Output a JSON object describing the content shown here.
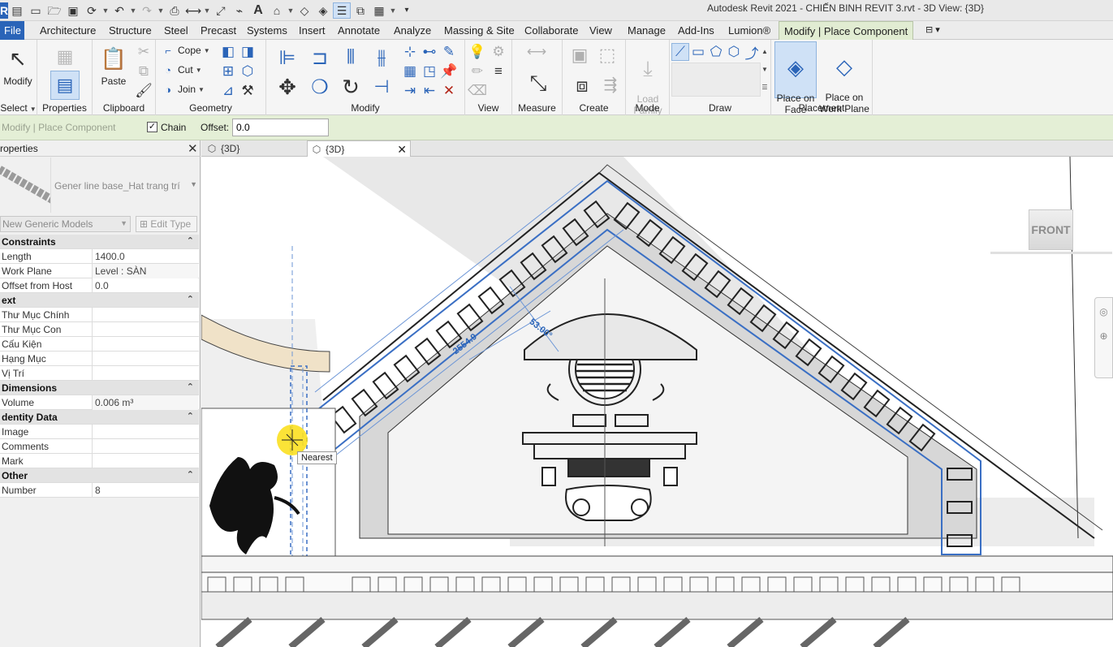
{
  "window": {
    "title": "Autodesk Revit 2021 - CHIẾN BINH REVIT 3.rvt - 3D View: {3D}"
  },
  "qat": {
    "icons": [
      "revit-logo",
      "open-icon",
      "new-icon",
      "open-folder-icon",
      "save-icon",
      "sync-icon",
      "undo-icon",
      "redo-icon",
      "print-icon",
      "measure-icon",
      "dimension-icon",
      "text-icon",
      "3d-view-icon",
      "section-icon",
      "thin-lines-icon",
      "switch-windows-icon",
      "customize-icon"
    ]
  },
  "tabs": [
    {
      "label": "File",
      "key": "file"
    },
    {
      "label": "Architecture"
    },
    {
      "label": "Structure"
    },
    {
      "label": "Steel"
    },
    {
      "label": "Precast"
    },
    {
      "label": "Systems"
    },
    {
      "label": "Insert"
    },
    {
      "label": "Annotate"
    },
    {
      "label": "Analyze"
    },
    {
      "label": "Massing & Site"
    },
    {
      "label": "Collaborate"
    },
    {
      "label": "View"
    },
    {
      "label": "Manage"
    },
    {
      "label": "Add-Ins"
    },
    {
      "label": "Lumion®"
    },
    {
      "label": "Modify | Place Component",
      "active": true
    }
  ],
  "ribbon": {
    "select": {
      "modify_label": "Modify",
      "title": "Select"
    },
    "properties": {
      "title": "Properties"
    },
    "clipboard": {
      "paste_label": "Paste",
      "title": "Clipboard"
    },
    "geometry": {
      "cope_label": "Cope",
      "cut_label": "Cut",
      "join_label": "Join",
      "title": "Geometry"
    },
    "modify": {
      "title": "Modify"
    },
    "view": {
      "title": "View"
    },
    "measure": {
      "title": "Measure"
    },
    "create": {
      "title": "Create"
    },
    "mode": {
      "load_family_label": "Load\nFamily",
      "title": "Mode"
    },
    "draw": {
      "title": "Draw"
    },
    "placement": {
      "place_on_face_label": "Place on\nFace",
      "place_on_work_plane_label": "Place on\nWork Plane",
      "title": "Placement"
    }
  },
  "options_bar": {
    "context_label": "Modify | Place Component",
    "chain_label": "Chain",
    "chain_checked": true,
    "offset_label": "Offset:",
    "offset_value": "0.0"
  },
  "properties_palette": {
    "title": "roperties",
    "type_name": "Gener line base_Hat trang trí",
    "instance_filter": "New Generic Models",
    "edit_type_label": "Edit Type",
    "rows": [
      {
        "section": "Constraints"
      },
      {
        "key": "Length",
        "value": "1400.0"
      },
      {
        "key": "Work Plane",
        "value": "Level : SÀN",
        "readonly": true
      },
      {
        "key": "Offset from Host",
        "value": "0.0"
      },
      {
        "section": "ext"
      },
      {
        "key": "Thư Mục Chính",
        "value": ""
      },
      {
        "key": "Thư Mục Con",
        "value": ""
      },
      {
        "key": "Cấu Kiện",
        "value": ""
      },
      {
        "key": "Hạng Mục",
        "value": ""
      },
      {
        "key": "Vị Trí",
        "value": ""
      },
      {
        "section": "Dimensions"
      },
      {
        "key": "Volume",
        "value": "0.006 m³",
        "readonly": true
      },
      {
        "section": "dentity Data"
      },
      {
        "key": "Image",
        "value": ""
      },
      {
        "key": "Comments",
        "value": ""
      },
      {
        "key": "Mark",
        "value": ""
      },
      {
        "section": "Other"
      },
      {
        "key": "Number",
        "value": "8"
      }
    ]
  },
  "view_tabs": [
    {
      "label": "{3D}"
    },
    {
      "label": "{3D}",
      "active": true
    }
  ],
  "viewport": {
    "viewcube_label": "FRONT",
    "snap_tooltip": "Nearest",
    "dim_length": "2554.9",
    "dim_angle": "53.00°"
  },
  "colors": {
    "file_tab": "#2a64b8",
    "context_tab": "#e1ecd2",
    "options_bar": "#e4efd6",
    "selection_blue": "#3a6fc4",
    "snap_yellow": "#fade14"
  }
}
